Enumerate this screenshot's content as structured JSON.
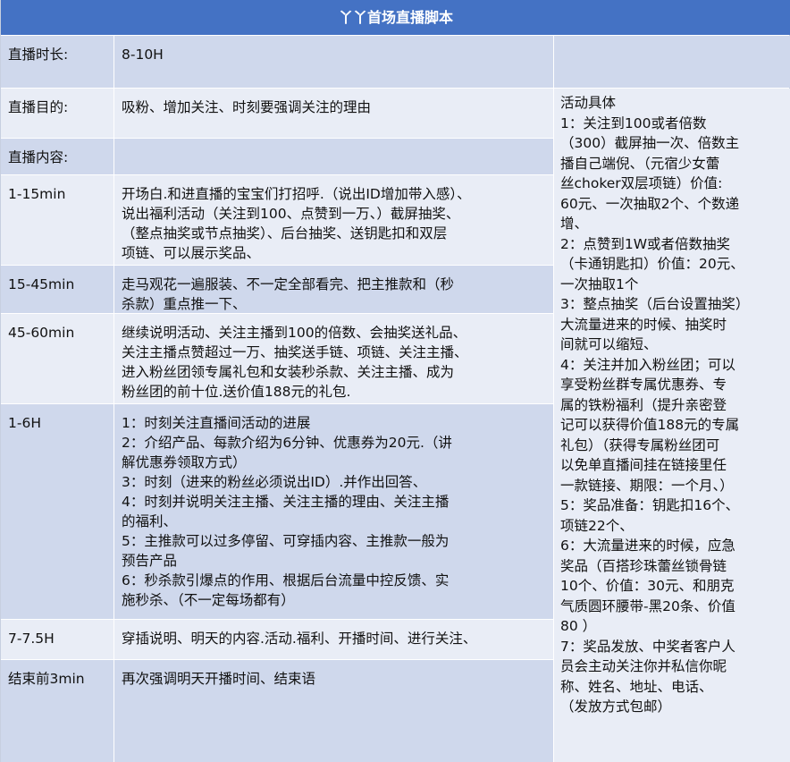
{
  "title": "丫丫首场直播脚本",
  "colors": {
    "header": "#4472c4",
    "row_dark": "#cfd8ec",
    "row_light": "#e9edf6"
  },
  "rows": [
    {
      "label": "直播时长:",
      "content": "8-10H"
    },
    {
      "label": "直播目的:",
      "content": "吸粉、增加关注、时刻要强调关注的理由"
    },
    {
      "label": "直播内容:",
      "content": ""
    },
    {
      "label": "1-15min",
      "content": "开场白.和进直播的宝宝们打招呼.（说出ID增加带入感）、\n说出福利活动（关注到100、点赞到一万、）截屏抽奖、\n（整点抽奖或节点抽奖）、后台抽奖、送钥匙扣和双层\n项链、可以展示奖品、"
    },
    {
      "label": "15-45min",
      "content": "走马观花一遍服装、不一定全部看完、把主推款和（秒\n杀款）重点推一下、"
    },
    {
      "label": "45-60min",
      "content": "继续说明活动、关注主播到100的倍数、会抽奖送礼品、\n关注主播点赞超过一万、抽奖送手链、项链、关注主播、\n进入粉丝团领专属礼包和女装秒杀款、关注主播、成为\n粉丝团的前十位.送价值188元的礼包."
    },
    {
      "label": "1-6H",
      "content": "1：时刻关注直播间活动的进展\n2：介绍产品、每款介绍为6分钟、优惠券为20元.（讲\n解优惠券领取方式）\n3：时刻（进来的粉丝必须说出ID）.并作出回答、\n4：时刻并说明关注主播、关注主播的理由、关注主播\n的福利、\n5：主推款可以过多停留、可穿插内容、主推款一般为\n预告产品\n6：秒杀款引爆点的作用、根据后台流量中控反馈、实\n施秒杀、（不一定每场都有）"
    },
    {
      "label": "7-7.5H",
      "content": "穿插说明、明天的内容.活动.福利、开播时间、进行关注、"
    },
    {
      "label": "结束前3min",
      "content": "再次强调明天开播时间、结束语"
    }
  ],
  "side": {
    "text": "活动具体\n1：关注到100或者倍数\n（300）截屏抽一次、倍数主\n播自己端倪、（元宿少女蕾\n丝choker双层项链）价值:\n60元、一次抽取2个、个数递\n增、\n2：点赞到1W或者倍数抽奖\n（卡通钥匙扣）价值：20元、\n一次抽取1个\n3：整点抽奖（后台设置抽奖）\n大流量进来的时候、抽奖时\n间就可以缩短、\n4：关注并加入粉丝团；可以\n享受粉丝群专属优惠券、专\n属的铁粉福利（提升亲密登\n记可以获得价值188元的专属\n礼包）（获得专属粉丝团可\n以免单直播间挂在链接里任\n一款链接、期限：一个月、）\n5：奖品准备：钥匙扣16个、\n项链22个、\n6：大流量进来的时候，应急\n奖品（百搭珍珠蕾丝锁骨链\n10个、价值：30元、和朋克\n气质圆环腰带-黑20条、价值\n80 ）\n7：奖品发放、中奖者客户人\n员会主动关注你并私信你昵\n称、姓名、地址、电话、\n（发放方式包邮）"
  }
}
